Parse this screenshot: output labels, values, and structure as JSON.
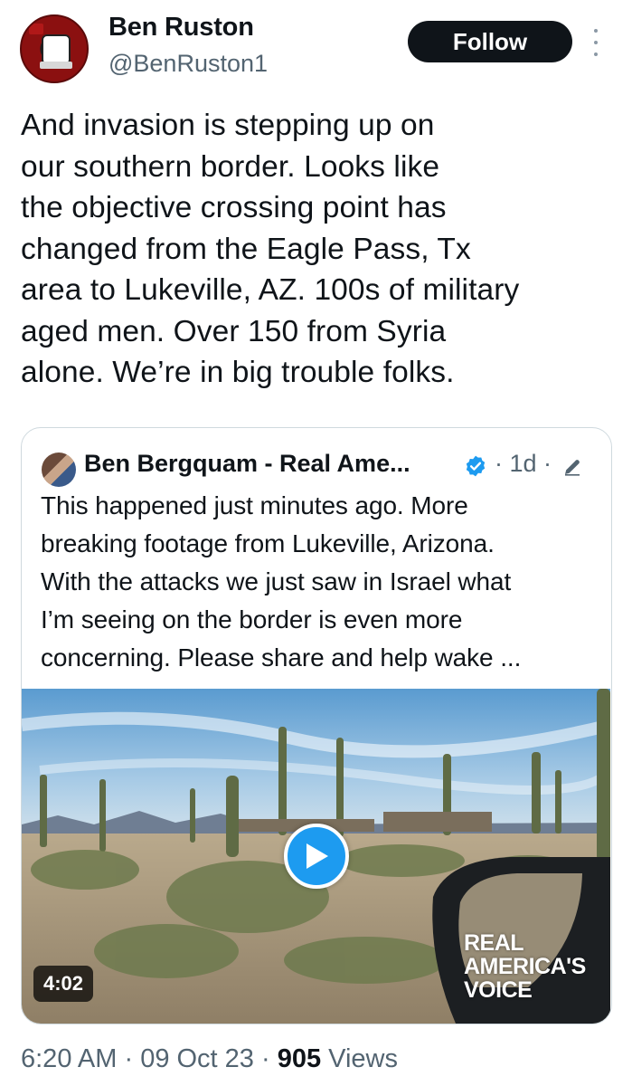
{
  "author": {
    "name": "Ben Ruston",
    "handle": "@BenRuston1"
  },
  "follow_label": "Follow",
  "tweet_text": "And invasion is stepping up on\nour southern border. Looks like\nthe objective crossing point has\nchanged from the Eagle Pass, Tx\narea to Lukeville, AZ. 100s of military\naged men. Over 150 from Syria\nalone. We’re in big trouble folks.",
  "quoted_tweet": {
    "author_name": "Ben Bergquam - Real Ame...",
    "meta": "· 1d ·",
    "text": "This happened just minutes ago. More\nbreaking footage from Lukeville, Arizona.\nWith the attacks we just saw in Israel what\nI’m seeing on the border is even more\nconcerning. Please share and help wake ...",
    "video": {
      "duration": "4:02",
      "watermark_line1": "REAL",
      "watermark_line2": "AMERICA'S",
      "watermark_line3": "VOICE"
    }
  },
  "footer": {
    "time": "6:20 AM",
    "date": "09 Oct 23",
    "views_count": "905",
    "views_label": "Views",
    "separator": " · "
  },
  "colors": {
    "accent_blue": "#1d9bf0",
    "text_primary": "#0f1419",
    "text_secondary": "#536471",
    "follow_button_bg": "#0f1419"
  }
}
